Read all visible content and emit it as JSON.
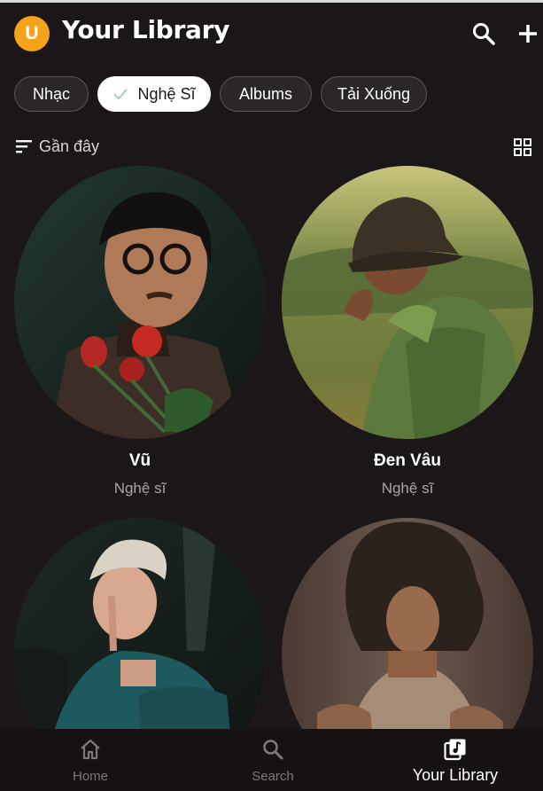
{
  "header": {
    "avatar_letter": "U",
    "title": "Your Library",
    "icons": [
      "search-icon",
      "plus-icon"
    ]
  },
  "filters": [
    {
      "label": "Nhạc",
      "selected": false
    },
    {
      "label": "Nghệ Sĩ",
      "selected": true
    },
    {
      "label": "Albums",
      "selected": false
    },
    {
      "label": "Tải Xuống",
      "selected": false
    }
  ],
  "sort": {
    "label": "Gần đây",
    "icon": "sort-lines-icon",
    "view_icon": "grid-view-icon"
  },
  "artists": [
    {
      "name": "Vũ",
      "subtitle": "Nghệ sĩ"
    },
    {
      "name": "Đen Vâu",
      "subtitle": "Nghệ sĩ"
    },
    {
      "name": "",
      "subtitle": ""
    },
    {
      "name": "",
      "subtitle": ""
    }
  ],
  "nav": [
    {
      "label": "Home",
      "icon": "home-icon",
      "active": false
    },
    {
      "label": "Search",
      "icon": "search-icon",
      "active": false
    },
    {
      "label": "Your Library",
      "icon": "library-icon",
      "active": true
    }
  ],
  "colors": {
    "background": "#1b1718",
    "avatar": "#f7a21b",
    "chip_bg": "#2b2728",
    "chip_selected_bg": "#ffffff",
    "muted_text": "#aaa5a6",
    "nav_inactive": "#7d7879"
  }
}
